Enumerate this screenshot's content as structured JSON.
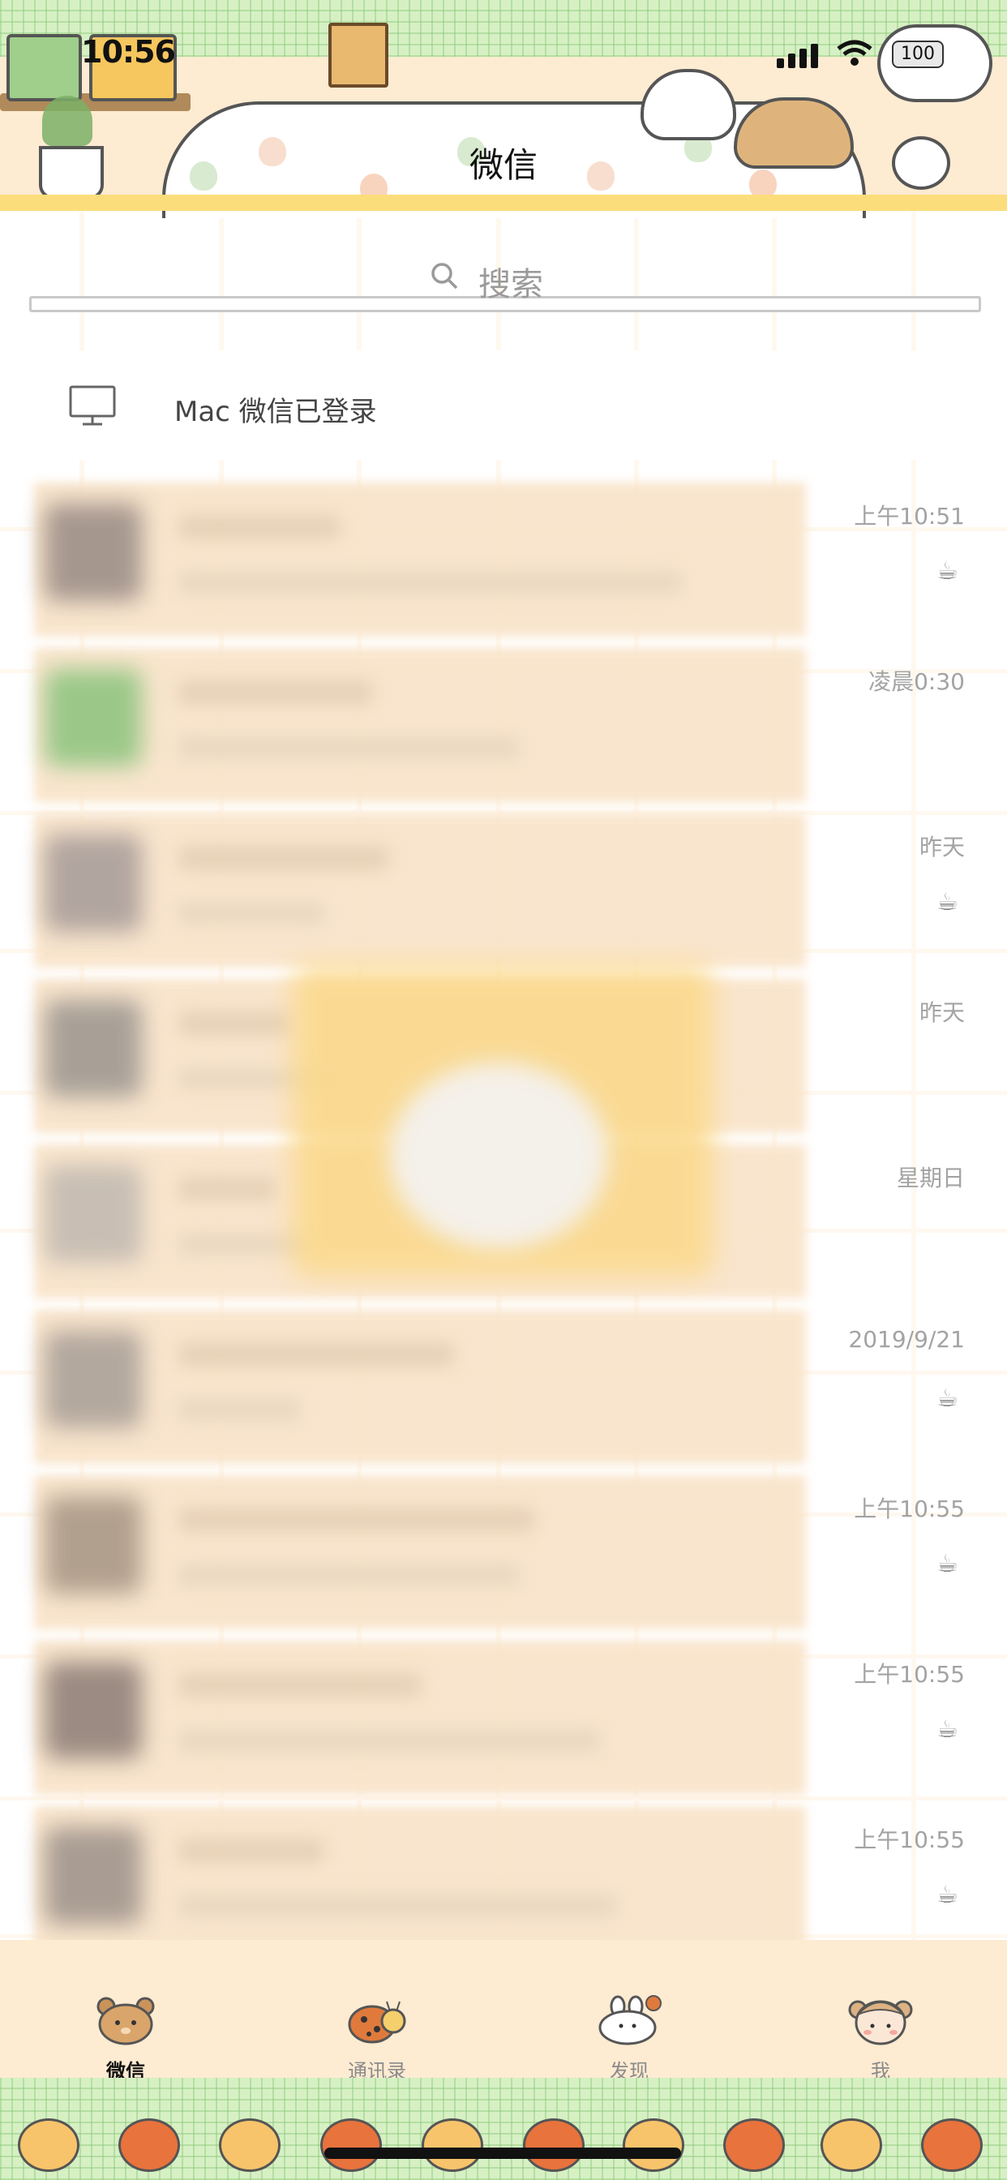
{
  "status_bar": {
    "time": "10:56",
    "battery": "100"
  },
  "header": {
    "title": "微信"
  },
  "search": {
    "placeholder": "搜索"
  },
  "mac_login": {
    "label": "Mac 微信已登录"
  },
  "chats": [
    {
      "time": "上午10:51",
      "muted": true
    },
    {
      "time": "凌晨0:30",
      "muted": false
    },
    {
      "time": "昨天",
      "muted": true
    },
    {
      "time": "昨天",
      "muted": false
    },
    {
      "time": "星期日",
      "muted": false
    },
    {
      "time": "2019/9/21",
      "muted": true
    },
    {
      "time": "上午10:55",
      "muted": true
    },
    {
      "time": "上午10:55",
      "muted": true
    },
    {
      "time": "上午10:55",
      "muted": true
    }
  ],
  "tabs": [
    {
      "label": "微信",
      "icon": "bear-icon",
      "active": true
    },
    {
      "label": "通讯录",
      "icon": "ladybug-icon",
      "active": false
    },
    {
      "label": "发现",
      "icon": "bunny-icon",
      "active": false
    },
    {
      "label": "我",
      "icon": "girl-face-icon",
      "active": false
    }
  ],
  "colors": {
    "background": "#fdebd2",
    "grid_line": "#fff8ef",
    "plaid_green": "#d6f0c4",
    "accent_yellow": "#fcdd7b",
    "time_text": "#a3a3a3"
  }
}
